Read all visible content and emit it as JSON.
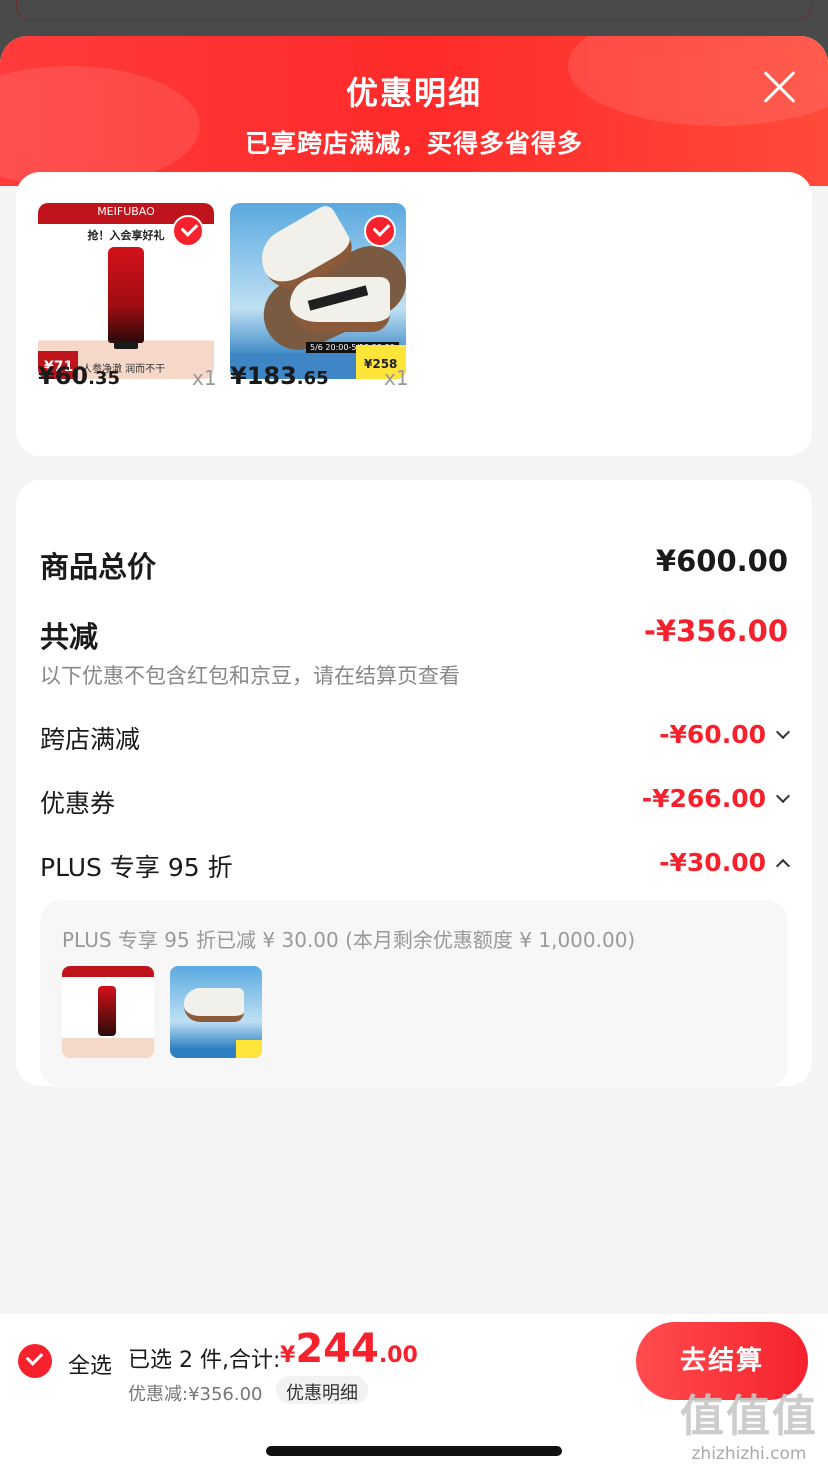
{
  "header": {
    "title": "优惠明细",
    "subtitle": "已享跨店满减，买得多省得多"
  },
  "products": [
    {
      "price_int": "¥60",
      "price_dec": ".35",
      "qty": "x1",
      "brand": "MEIFUBAO",
      "promo": "抢！入会享好礼",
      "tag": "¥71",
      "footer": "人参净澈 润而不干",
      "selected": true
    },
    {
      "price_int": "¥183",
      "price_dec": ".65",
      "qty": "x1",
      "date": "5/6 20:00-5/12 23:59",
      "tag": "¥258",
      "selected": true
    }
  ],
  "summary": {
    "total_label": "商品总价",
    "total_value": "¥600.00",
    "reduce_label": "共减",
    "reduce_value": "-¥356.00",
    "note": "以下优惠不包含红包和京豆，请在结算页查看",
    "items": [
      {
        "label": "跨店满减",
        "value": "-¥60.00",
        "expanded": false
      },
      {
        "label": "优惠券",
        "value": "-¥266.00",
        "expanded": false
      },
      {
        "label": "PLUS 专享 95 折",
        "value": "-¥30.00",
        "expanded": true
      }
    ],
    "plus_detail": "PLUS 专享 95 折已减 ¥ 30.00 (本月剩余优惠额度 ¥ 1,000.00)"
  },
  "bottom": {
    "select_all": "全选",
    "selected_text": "已选 2 件,合计:",
    "total_sym": "¥",
    "total_int": "244",
    "total_dec": ".00",
    "saved": "优惠减:¥356.00",
    "detail_chip": "优惠明细",
    "checkout": "去结算"
  },
  "watermark": {
    "main": "值值值",
    "site": "zhizhizhi.com"
  },
  "colors": {
    "accent": "#f5222d",
    "header": "#ff3b3b"
  }
}
